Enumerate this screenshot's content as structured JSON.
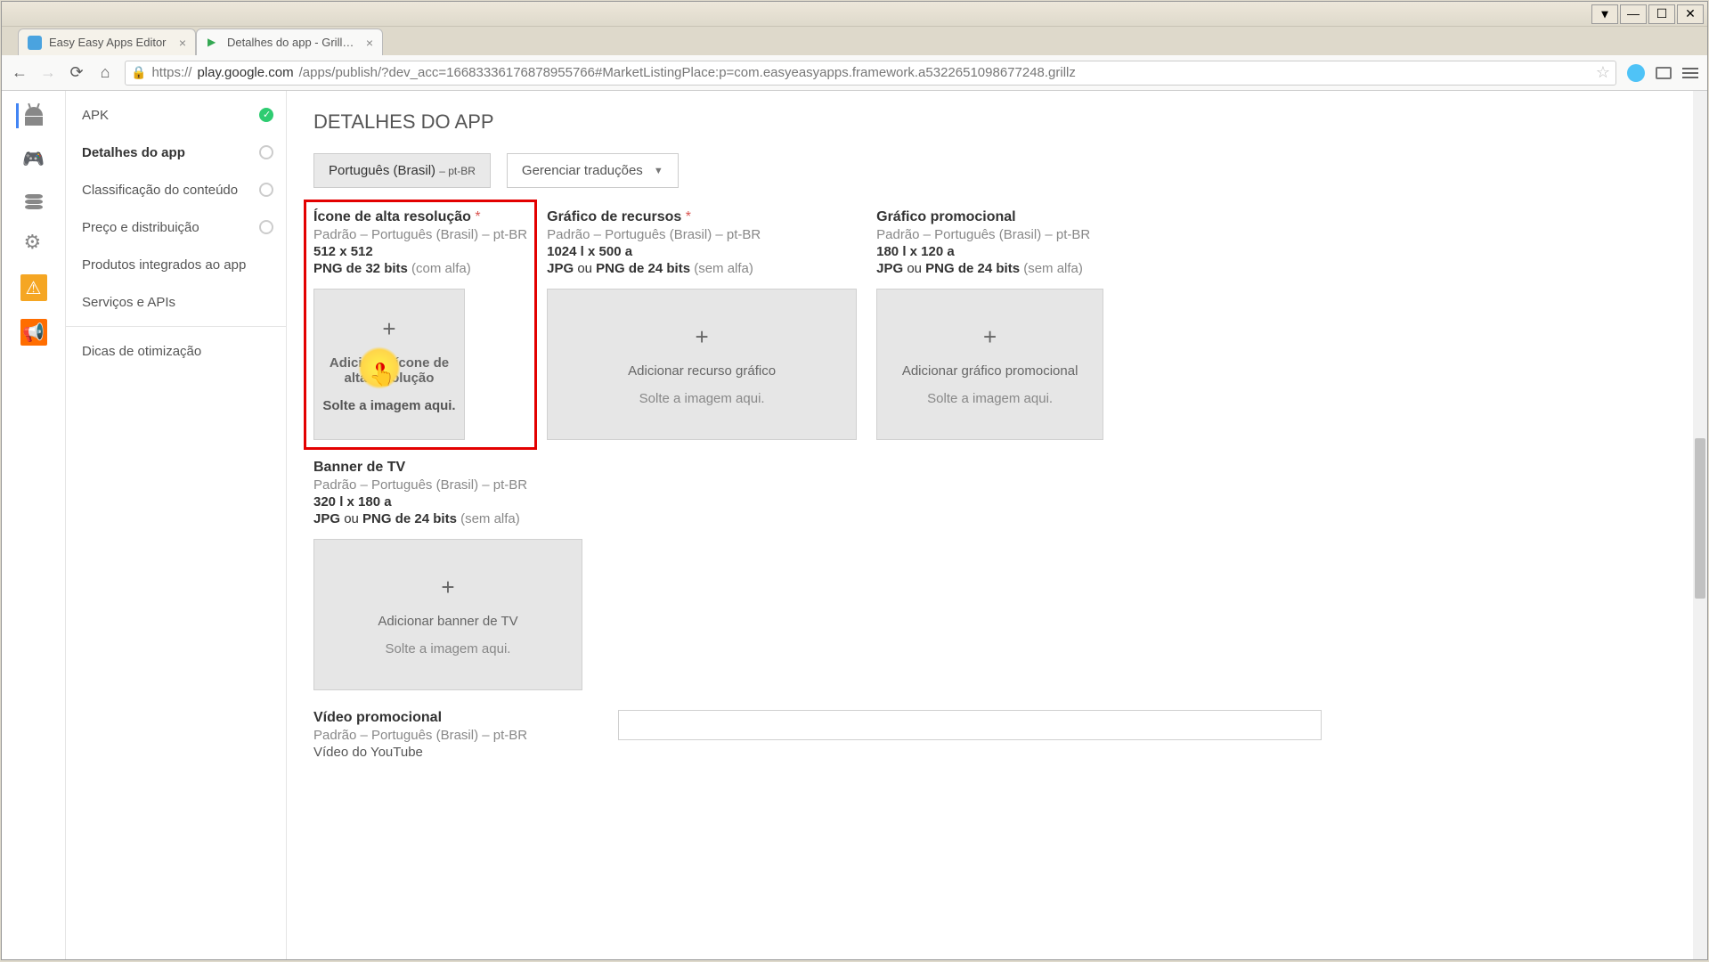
{
  "os": {
    "down": "▾",
    "min": "—",
    "max": "☐",
    "close": "✕"
  },
  "tabs": [
    {
      "title": "Easy Easy Apps Editor"
    },
    {
      "title": "Detalhes do app - Grillz re"
    }
  ],
  "url": {
    "scheme": "https://",
    "host": "play.google.com",
    "path": "/apps/publish/?dev_acc=16683336176878955766#MarketListingPlace:p=com.easyeasyapps.framework.a5322651098677248.grillz"
  },
  "sidenav": {
    "items": [
      {
        "label": "APK",
        "done": true
      },
      {
        "label": "Detalhes do app",
        "done": false,
        "active": true
      },
      {
        "label": "Classificação do conteúdo",
        "done": false
      },
      {
        "label": "Preço e distribuição",
        "done": false
      },
      {
        "label": "Produtos integrados ao app",
        "done": false
      },
      {
        "label": "Serviços e APIs",
        "done": false
      }
    ],
    "extra": "Dicas de otimização"
  },
  "page": {
    "title": "DETALHES DO APP",
    "lang_label": "Português (Brasil)",
    "lang_suffix": "– pt-BR",
    "manage": "Gerenciar traduções"
  },
  "assets": {
    "icon": {
      "title": "Ícone de alta resolução",
      "req": "*",
      "sub": "Padrão – Português (Brasil) – pt-BR",
      "dim": "512 x 512",
      "fmt_bold": "PNG de 32 bits",
      "fmt_muted": "(com alfa)",
      "action": "Adicionar ícone de alta resolução",
      "drop": "Solte a imagem aqui."
    },
    "feature": {
      "title": "Gráfico de recursos",
      "req": "*",
      "sub": "Padrão – Português (Brasil) – pt-BR",
      "dim": "1024 l x 500 a",
      "fmt_pre": "JPG",
      "fmt_or": "ou",
      "fmt_bold": "PNG de 24 bits",
      "fmt_muted": "(sem alfa)",
      "action": "Adicionar recurso gráfico",
      "drop": "Solte a imagem aqui."
    },
    "promo": {
      "title": "Gráfico promocional",
      "sub": "Padrão – Português (Brasil) – pt-BR",
      "dim": "180 l x 120 a",
      "fmt_pre": "JPG",
      "fmt_or": "ou",
      "fmt_bold": "PNG de 24 bits",
      "fmt_muted": "(sem alfa)",
      "action": "Adicionar gráfico promocional",
      "drop": "Solte a imagem aqui."
    },
    "tv": {
      "title": "Banner de TV",
      "sub": "Padrão – Português (Brasil) – pt-BR",
      "dim": "320 l x 180 a",
      "fmt_pre": "JPG",
      "fmt_or": "ou",
      "fmt_bold": "PNG de 24 bits",
      "fmt_muted": "(sem alfa)",
      "action": "Adicionar banner de TV",
      "drop": "Solte a imagem aqui."
    },
    "video": {
      "title": "Vídeo promocional",
      "sub": "Padrão – Português (Brasil) – pt-BR",
      "dim": "Vídeo do YouTube"
    }
  }
}
